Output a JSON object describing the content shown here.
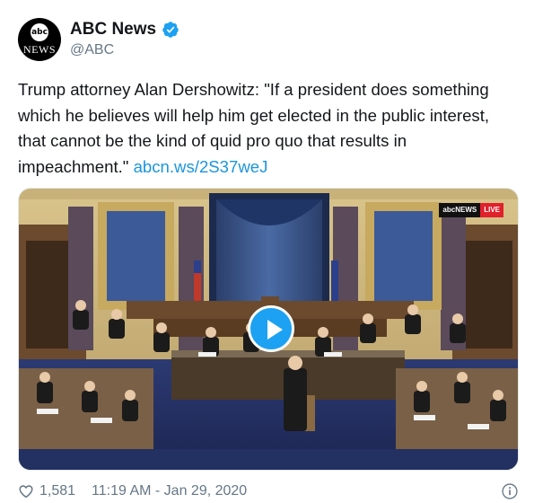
{
  "account": {
    "display_name": "ABC News",
    "handle": "@ABC",
    "avatar_top": "abc",
    "avatar_bottom": "NEWS"
  },
  "tweet": {
    "text": "Trump attorney Alan Dershowitz: \"If a president does something which he believes will help him get elected in the public interest, that cannot be the kind of quid pro quo that results in impeachment.\"",
    "link": "abcn.ws/2S37weJ"
  },
  "media": {
    "badge_logo": "abcNEWS",
    "badge_live": "LIVE"
  },
  "footer": {
    "likes": "1,581",
    "timestamp": "11:19 AM - Jan 29, 2020"
  },
  "colors": {
    "link": "#1b95e0",
    "verified": "#1da1f2",
    "secondary_text": "#657786"
  },
  "icons": [
    "verified-badge-icon",
    "play-icon",
    "heart-icon",
    "info-icon"
  ]
}
